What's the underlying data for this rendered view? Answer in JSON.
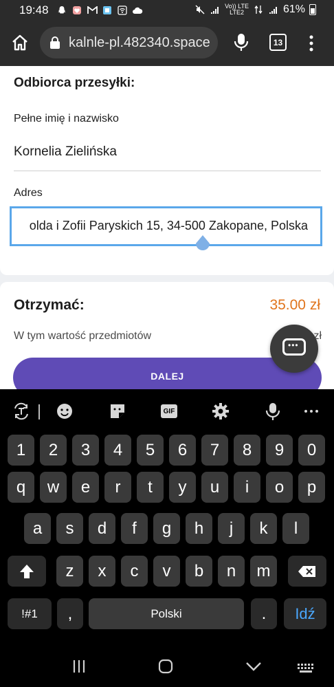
{
  "status_bar": {
    "time": "19:48",
    "battery": "61%",
    "lte_top": "Vo)) LTE",
    "lte_bottom": "LTE2"
  },
  "browser": {
    "url": "kalnle-pl.482340.space",
    "tab_count": "13"
  },
  "recipient": {
    "title": "Odbiorca przesyłki:",
    "name_label": "Pełne imię i nazwisko",
    "name_value": "Kornelia Zielińska",
    "address_label": "Adres",
    "address_value": "olda i Zofii Paryskich 15, 34-500 Zakopane, Polska"
  },
  "summary": {
    "receive_label": "Otrzymać:",
    "receive_value": "35.00 zł",
    "items_label": "W tym wartość przedmiotów",
    "items_value": "zł",
    "next_button": "DALEJ"
  },
  "keyboard": {
    "row_numbers": [
      "1",
      "2",
      "3",
      "4",
      "5",
      "6",
      "7",
      "8",
      "9",
      "0"
    ],
    "row_top": [
      "q",
      "w",
      "e",
      "r",
      "t",
      "y",
      "u",
      "i",
      "o",
      "p"
    ],
    "row_middle": [
      "a",
      "s",
      "d",
      "f",
      "g",
      "h",
      "j",
      "k",
      "l"
    ],
    "row_bottom": [
      "z",
      "x",
      "c",
      "v",
      "b",
      "n",
      "m"
    ],
    "symbols_key": "!#1",
    "comma_key": ",",
    "space_key": "Polski",
    "period_key": ".",
    "go_key": "Idź",
    "gif_label": "GIF"
  },
  "colors": {
    "accent_button": "#5f4bb6",
    "price": "#e0741c",
    "input_focus": "#5aa7ea",
    "go_key": "#4aa8ff"
  }
}
